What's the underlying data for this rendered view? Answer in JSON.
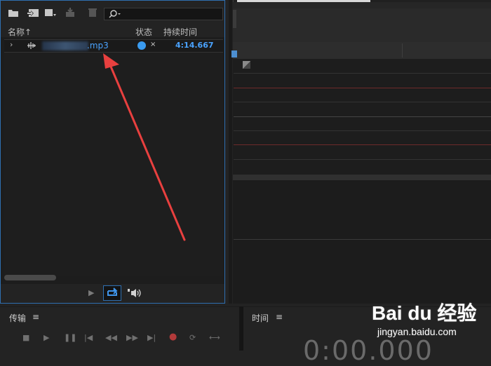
{
  "files_panel": {
    "columns": {
      "name": "名称",
      "status": "状态",
      "duration": "持续时间"
    },
    "sort_indicator": "↑",
    "search": {
      "placeholder": ""
    },
    "file": {
      "name": ".mp3",
      "status_close": "×",
      "duration": "4:14.667"
    }
  },
  "transport": {
    "title": "传输",
    "menu": "≡"
  },
  "time_panel": {
    "title": "时间",
    "menu": "≡",
    "display": "0:00.000"
  },
  "watermark": {
    "logo": "Bai du 经验",
    "url": "jingyan.baidu.com"
  },
  "colors": {
    "accent": "#2f6fb0",
    "file_text": "#4aa3ff",
    "status_dot": "#3a9bf0",
    "annotation_arrow": "#e8403f",
    "record_red": "#b23a3a"
  },
  "icons": [
    "folder-open-icon",
    "import-icon",
    "insert-icon",
    "export-icon",
    "delete-icon",
    "search-icon",
    "waveform-icon",
    "play-icon",
    "loop-icon",
    "speaker-icon"
  ]
}
